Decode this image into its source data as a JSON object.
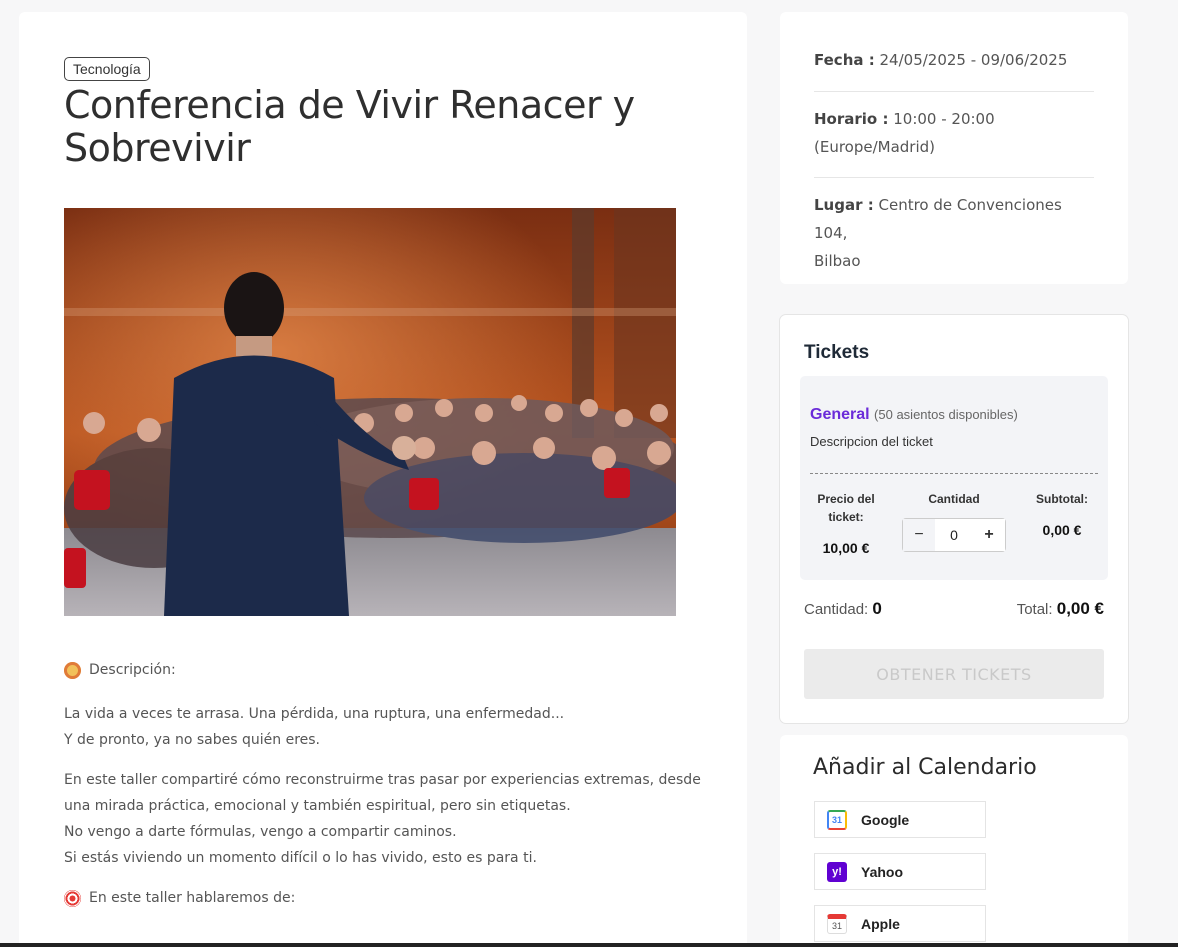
{
  "event": {
    "category": "Tecnología",
    "title": "Conferencia de Vivir Renacer y Sobrevivir",
    "image_alt": "Conference speaker in front of audience"
  },
  "description": {
    "heading": "Descripción:",
    "para1_line1": "La vida a veces te arrasa. Una pérdida, una ruptura, una enfermedad...",
    "para1_line2": "Y de pronto, ya no sabes quién eres.",
    "para2_line1": "En este taller compartiré cómo reconstruirme tras pasar por experiencias extremas, desde",
    "para2_line2": "una mirada práctica, emocional y también espiritual, pero sin etiquetas.",
    "para2_line3": "No vengo a darte fórmulas, vengo a compartir caminos.",
    "para2_line4": "Si estás viviendo un momento difícil o lo has vivido, esto es para ti.",
    "topics_heading": "En este taller hablaremos de:"
  },
  "info": {
    "date_label": "Fecha :",
    "date_value": "24/05/2025 - 09/06/2025",
    "time_label": "Horario :",
    "time_value": "10:00 - 20:00",
    "timezone": "(Europe/Madrid)",
    "place_label": "Lugar :",
    "place_line1": "Centro de Convenciones 104,",
    "place_line2": "Bilbao"
  },
  "tickets": {
    "title": "Tickets",
    "ticket_name": "General",
    "availability": "(50 asientos disponibles)",
    "ticket_description": "Descripcion del ticket",
    "price_label_1": "Precio del",
    "price_label_2": "ticket:",
    "price_value": "10,00 €",
    "quantity_label": "Cantidad",
    "quantity_value": "0",
    "minus": "−",
    "plus": "+",
    "subtotal_label": "Subtotal:",
    "subtotal_value": "0,00 €",
    "summary_qty_label": "Cantidad:",
    "summary_qty_value": "0",
    "summary_total_label": "Total:",
    "summary_total_value": "0,00 €",
    "cta": "OBTENER TICKETS"
  },
  "calendar": {
    "title": "Añadir al Calendario",
    "google": "Google",
    "yahoo": "Yahoo",
    "apple": "Apple",
    "google_icon_text": "31",
    "yahoo_icon_text": "y!",
    "apple_icon_text": "31"
  },
  "colors": {
    "accent_purple": "#6b2bd9",
    "button_disabled": "#ebebeb",
    "google_blue": "#4285f4",
    "yahoo_purple": "#6001d2",
    "apple_red": "#e53935"
  }
}
